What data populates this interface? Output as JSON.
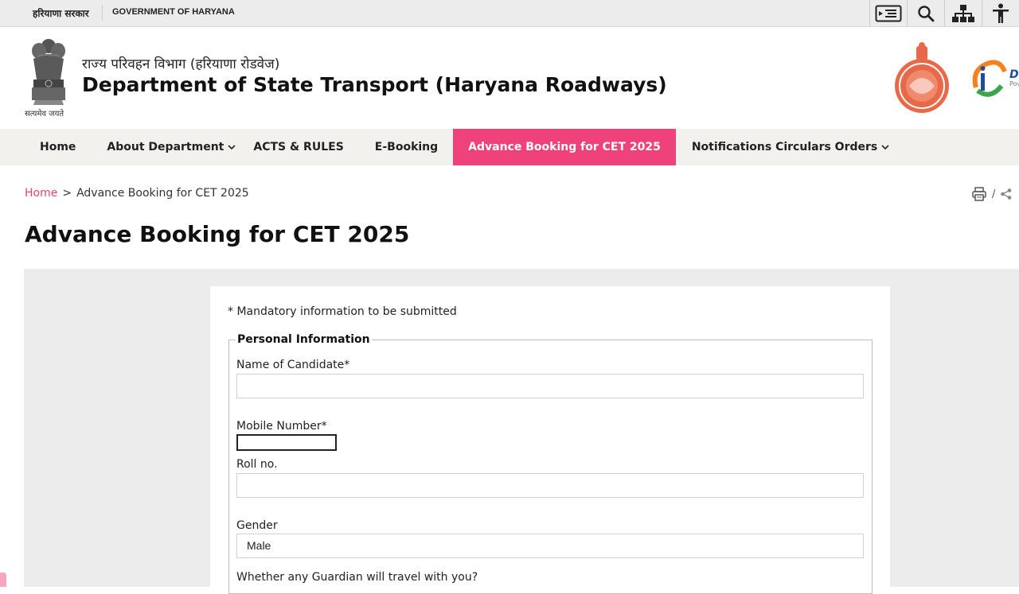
{
  "govbar": {
    "hindi": "हरियाणा सरकार",
    "english": "GOVERNMENT OF HARYANA",
    "tools": [
      {
        "icon": "skip-to-content-icon"
      },
      {
        "icon": "search-icon"
      },
      {
        "icon": "sitemap-icon"
      },
      {
        "icon": "accessibility-icon"
      }
    ]
  },
  "header": {
    "emblem_caption": "सत्यमेव जयते",
    "subtitle": "राज्य परिवहन विभाग (हरियाणा रोडवेज)",
    "title": "Department of State Transport (Haryana Roadways)"
  },
  "nav": {
    "items": [
      {
        "label": "Home"
      },
      {
        "label": "About Department"
      },
      {
        "label": "ACTS & RULES"
      },
      {
        "label": "E-Booking"
      },
      {
        "label": "Advance Booking for CET 2025"
      },
      {
        "label": "Notifications Circulars Orders"
      }
    ]
  },
  "breadcrumb": {
    "home": "Home",
    "separator": ">",
    "current": "Advance Booking for CET 2025"
  },
  "page_tools": {
    "separator": "/"
  },
  "page": {
    "title": "Advance Booking for CET 2025"
  },
  "form": {
    "mandatory_note": "* Mandatory information to be submitted",
    "legend": "Personal Information",
    "name_label": "Name of Candidate*",
    "mobile_label": "Mobile Number*",
    "roll_label": "Roll no.",
    "gender_label": "Gender",
    "gender_value": "Male",
    "guardian_label": "Whether any Guardian will travel with you?"
  },
  "colors": {
    "accent": "#f0427a",
    "link": "#e8436f"
  }
}
